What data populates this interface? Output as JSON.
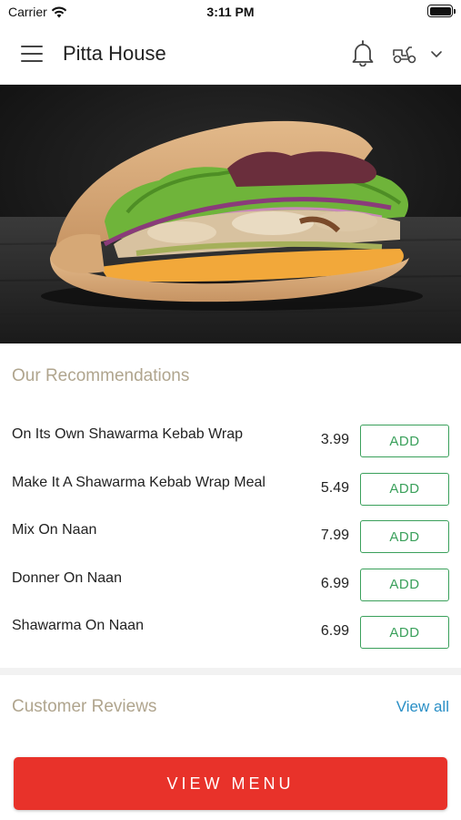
{
  "status_bar": {
    "carrier": "Carrier",
    "time": "3:11 PM",
    "icons": [
      "wifi-icon",
      "battery-icon"
    ]
  },
  "header": {
    "title": "Pitta House",
    "icons": [
      "hamburger-menu-icon",
      "bell-icon",
      "scooter-delivery-icon",
      "chevron-down-icon"
    ]
  },
  "hero": {
    "alt_subject": "shawarma-wrap-photo"
  },
  "recommendations": {
    "title": "Our Recommendations",
    "items": [
      {
        "name": "On Its Own Shawarma Kebab Wrap",
        "price": "3.99",
        "button": "ADD"
      },
      {
        "name": "Make It A Shawarma Kebab Wrap Meal",
        "price": "5.49",
        "button": "ADD"
      },
      {
        "name": "Mix On Naan",
        "price": "7.99",
        "button": "ADD"
      },
      {
        "name": "Donner On Naan",
        "price": "6.99",
        "button": "ADD"
      },
      {
        "name": "Shawarma On Naan",
        "price": "6.99",
        "button": "ADD"
      }
    ]
  },
  "reviews": {
    "title": "Customer Reviews",
    "view_all": "View all"
  },
  "cta": {
    "label": "VIEW MENU"
  },
  "colors": {
    "accent_red": "#e8322a",
    "add_green": "#3aa05b",
    "link_blue": "#2a8fc6",
    "section_title_tan": "#b0a58e"
  }
}
